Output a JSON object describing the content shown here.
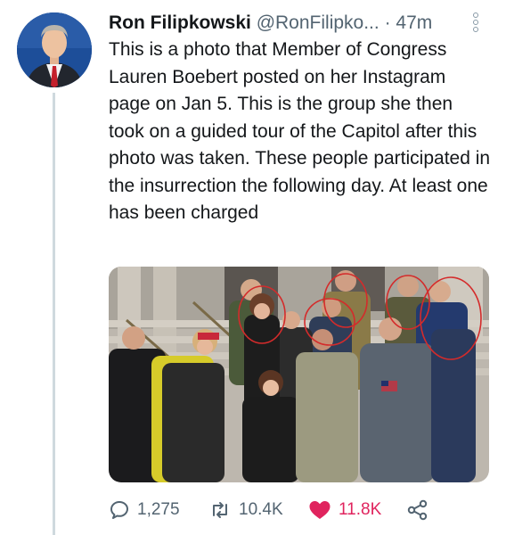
{
  "tweet": {
    "author_name": "Ron Filipkowski",
    "author_handle": "@RonFilipko...",
    "separator": "·",
    "time": "47m",
    "text": "This is a photo that Member of Congress Lauren Boebert posted on her Instagram page on Jan 5. This is the group she then took on a guided tour of the Capitol after this photo was taken. These people participated in the insurrection the following day. At least one has been charged"
  },
  "actions": {
    "replies": "1,275",
    "retweets": "10.4K",
    "likes": "11.8K"
  },
  "icons": {
    "reply": "reply-icon",
    "retweet": "retweet-icon",
    "like": "heart-icon",
    "share": "share-icon",
    "more": "more-options-icon"
  },
  "colors": {
    "like_active": "#e0245e",
    "secondary_text": "#536471",
    "thread_line": "#cfd9de",
    "annotation_circles": "#d42b2b"
  }
}
